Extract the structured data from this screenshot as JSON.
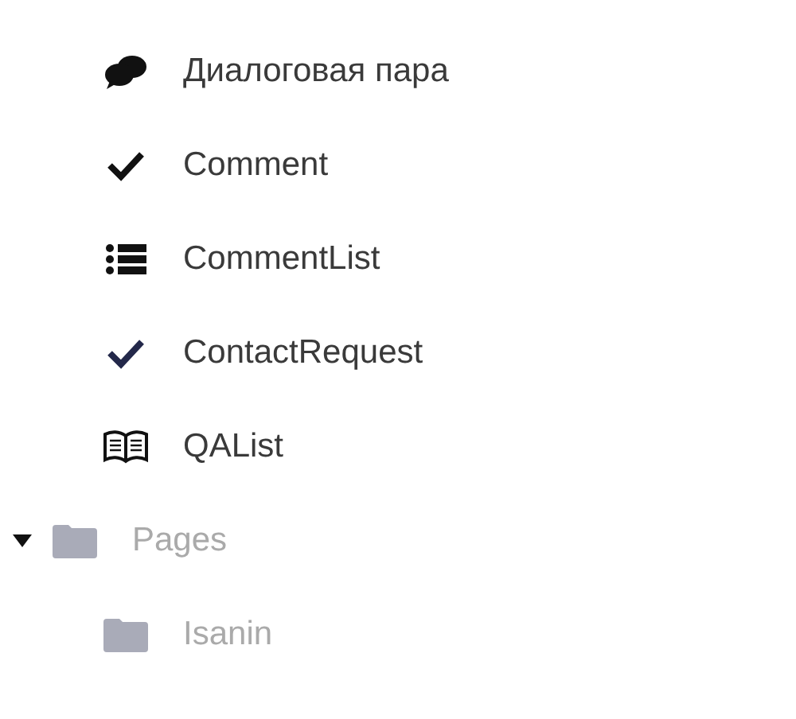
{
  "items": [
    {
      "kind": "dialog",
      "label": "Диалоговая пара"
    },
    {
      "kind": "check",
      "label": "Comment"
    },
    {
      "kind": "list",
      "label": "CommentList"
    },
    {
      "kind": "check-dark",
      "label": "ContactRequest"
    },
    {
      "kind": "book",
      "label": "QAList"
    }
  ],
  "tree": [
    {
      "kind": "folder",
      "label": "Pages",
      "expanded": true,
      "children": [
        {
          "kind": "folder",
          "label": "Isanin"
        }
      ]
    }
  ]
}
